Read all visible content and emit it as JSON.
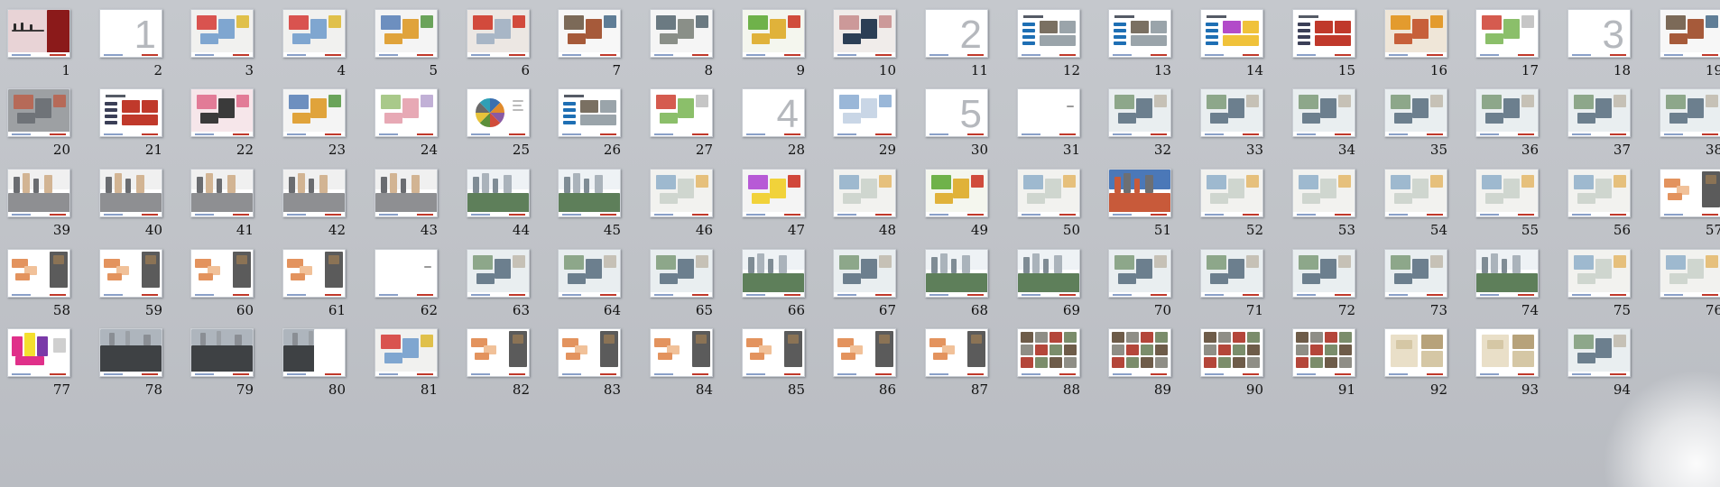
{
  "view": "slide-sorter",
  "accent_color": "#c0392b",
  "slides": [
    {
      "number": "1",
      "kind": "cover"
    },
    {
      "number": "2",
      "kind": "section",
      "label": "1"
    },
    {
      "number": "3",
      "kind": "map"
    },
    {
      "number": "4",
      "kind": "map"
    },
    {
      "number": "5",
      "kind": "collage"
    },
    {
      "number": "6",
      "kind": "map-circle"
    },
    {
      "number": "7",
      "kind": "photos"
    },
    {
      "number": "8",
      "kind": "panorama"
    },
    {
      "number": "9",
      "kind": "plan-green"
    },
    {
      "number": "10",
      "kind": "plan-dark"
    },
    {
      "number": "11",
      "kind": "section",
      "label": "2"
    },
    {
      "number": "12",
      "kind": "text-photos"
    },
    {
      "number": "13",
      "kind": "text-photos"
    },
    {
      "number": "14",
      "kind": "text-diagram"
    },
    {
      "number": "15",
      "kind": "text-photo"
    },
    {
      "number": "16",
      "kind": "map-orange"
    },
    {
      "number": "17",
      "kind": "diagram"
    },
    {
      "number": "18",
      "kind": "section",
      "label": "3"
    },
    {
      "number": "19",
      "kind": "photos"
    },
    {
      "number": "20",
      "kind": "map-wide"
    },
    {
      "number": "21",
      "kind": "text-photo"
    },
    {
      "number": "22",
      "kind": "collage-pink"
    },
    {
      "number": "23",
      "kind": "collage"
    },
    {
      "number": "24",
      "kind": "table-color"
    },
    {
      "number": "25",
      "kind": "pie"
    },
    {
      "number": "26",
      "kind": "text-photos"
    },
    {
      "number": "27",
      "kind": "diagram"
    },
    {
      "number": "28",
      "kind": "section",
      "label": "4"
    },
    {
      "number": "29",
      "kind": "maps-blue"
    },
    {
      "number": "30",
      "kind": "section",
      "label": "5"
    },
    {
      "number": "31",
      "kind": "blank"
    },
    {
      "number": "32",
      "kind": "render"
    },
    {
      "number": "33",
      "kind": "render"
    },
    {
      "number": "34",
      "kind": "render"
    },
    {
      "number": "35",
      "kind": "render"
    },
    {
      "number": "36",
      "kind": "render"
    },
    {
      "number": "37",
      "kind": "render"
    },
    {
      "number": "38",
      "kind": "render"
    },
    {
      "number": "39",
      "kind": "street"
    },
    {
      "number": "40",
      "kind": "street"
    },
    {
      "number": "41",
      "kind": "street"
    },
    {
      "number": "42",
      "kind": "street"
    },
    {
      "number": "43",
      "kind": "street"
    },
    {
      "number": "44",
      "kind": "skyline"
    },
    {
      "number": "45",
      "kind": "skyline"
    },
    {
      "number": "46",
      "kind": "plan"
    },
    {
      "number": "47",
      "kind": "plan-color"
    },
    {
      "number": "48",
      "kind": "plan"
    },
    {
      "number": "49",
      "kind": "plan-green"
    },
    {
      "number": "50",
      "kind": "plan"
    },
    {
      "number": "51",
      "kind": "photo-sky"
    },
    {
      "number": "52",
      "kind": "plan"
    },
    {
      "number": "53",
      "kind": "plan"
    },
    {
      "number": "54",
      "kind": "plan"
    },
    {
      "number": "55",
      "kind": "plan"
    },
    {
      "number": "56",
      "kind": "plan"
    },
    {
      "number": "57",
      "kind": "plan-orange"
    },
    {
      "number": "58",
      "kind": "plan-orange"
    },
    {
      "number": "59",
      "kind": "plan-orange"
    },
    {
      "number": "60",
      "kind": "plan-orange"
    },
    {
      "number": "61",
      "kind": "plan-orange"
    },
    {
      "number": "62",
      "kind": "blank"
    },
    {
      "number": "63",
      "kind": "render"
    },
    {
      "number": "64",
      "kind": "render"
    },
    {
      "number": "65",
      "kind": "render"
    },
    {
      "number": "66",
      "kind": "skyline"
    },
    {
      "number": "67",
      "kind": "render"
    },
    {
      "number": "68",
      "kind": "skyline"
    },
    {
      "number": "69",
      "kind": "skyline"
    },
    {
      "number": "70",
      "kind": "render"
    },
    {
      "number": "71",
      "kind": "render"
    },
    {
      "number": "72",
      "kind": "render"
    },
    {
      "number": "73",
      "kind": "render"
    },
    {
      "number": "74",
      "kind": "skyline"
    },
    {
      "number": "75",
      "kind": "plan"
    },
    {
      "number": "76",
      "kind": "plan"
    },
    {
      "number": "77",
      "kind": "logo-color"
    },
    {
      "number": "78",
      "kind": "render-dark"
    },
    {
      "number": "79",
      "kind": "render-dark"
    },
    {
      "number": "80",
      "kind": "render-dark"
    },
    {
      "number": "81",
      "kind": "map"
    },
    {
      "number": "82",
      "kind": "plan-orange"
    },
    {
      "number": "83",
      "kind": "plan-orange"
    },
    {
      "number": "84",
      "kind": "plan-orange"
    },
    {
      "number": "85",
      "kind": "plan-orange"
    },
    {
      "number": "86",
      "kind": "plan-orange"
    },
    {
      "number": "87",
      "kind": "plan-orange"
    },
    {
      "number": "88",
      "kind": "photo-grid"
    },
    {
      "number": "89",
      "kind": "photo-grid"
    },
    {
      "number": "90",
      "kind": "photo-grid"
    },
    {
      "number": "91",
      "kind": "photo-grid"
    },
    {
      "number": "92",
      "kind": "floorplan"
    },
    {
      "number": "93",
      "kind": "floorplan"
    },
    {
      "number": "94",
      "kind": "render"
    }
  ]
}
